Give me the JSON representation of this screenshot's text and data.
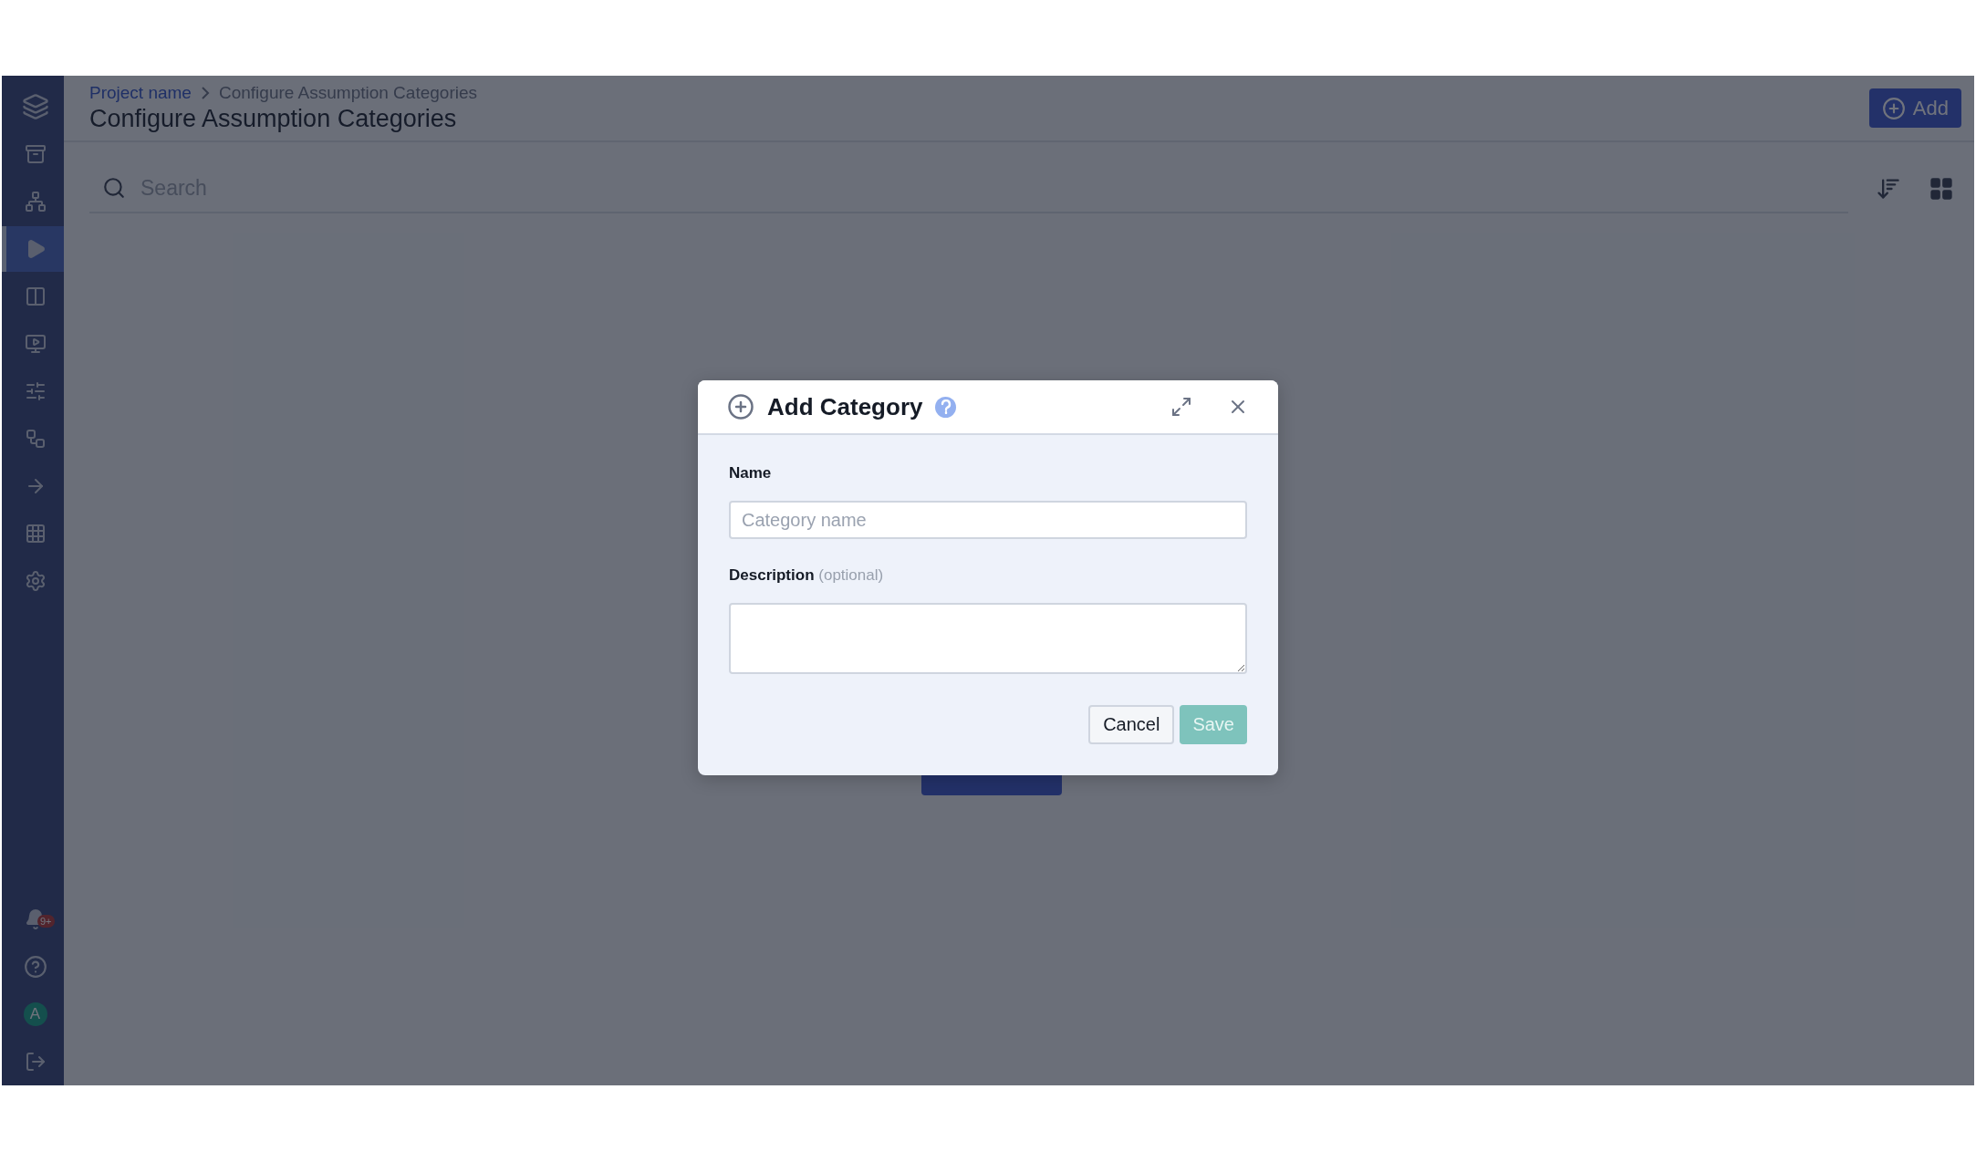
{
  "sidebar": {
    "items": [
      {
        "selected": false
      },
      {
        "selected": false
      },
      {
        "selected": true
      },
      {
        "selected": false
      },
      {
        "selected": false
      },
      {
        "selected": false
      },
      {
        "selected": false
      },
      {
        "selected": false
      },
      {
        "selected": false
      },
      {
        "selected": false
      }
    ],
    "notification_badge": "9+",
    "avatar": "A"
  },
  "header": {
    "breadcrumb": [
      "Project name",
      "Configure Assumption Categories"
    ],
    "title": "Configure Assumption Categories",
    "add_button": "Add"
  },
  "search": {
    "placeholder": "Search"
  },
  "dialog": {
    "title": "Add Category",
    "fields": [
      {
        "kind": "input",
        "label": "Name",
        "placeholder": "Category name"
      },
      {
        "kind": "textarea",
        "label": "Description",
        "hint": "(optional)"
      }
    ],
    "buttons": [
      {
        "label": "Cancel",
        "kind": "secondary",
        "disabled": false
      },
      {
        "label": "Save",
        "kind": "primary",
        "disabled": true
      }
    ]
  }
}
